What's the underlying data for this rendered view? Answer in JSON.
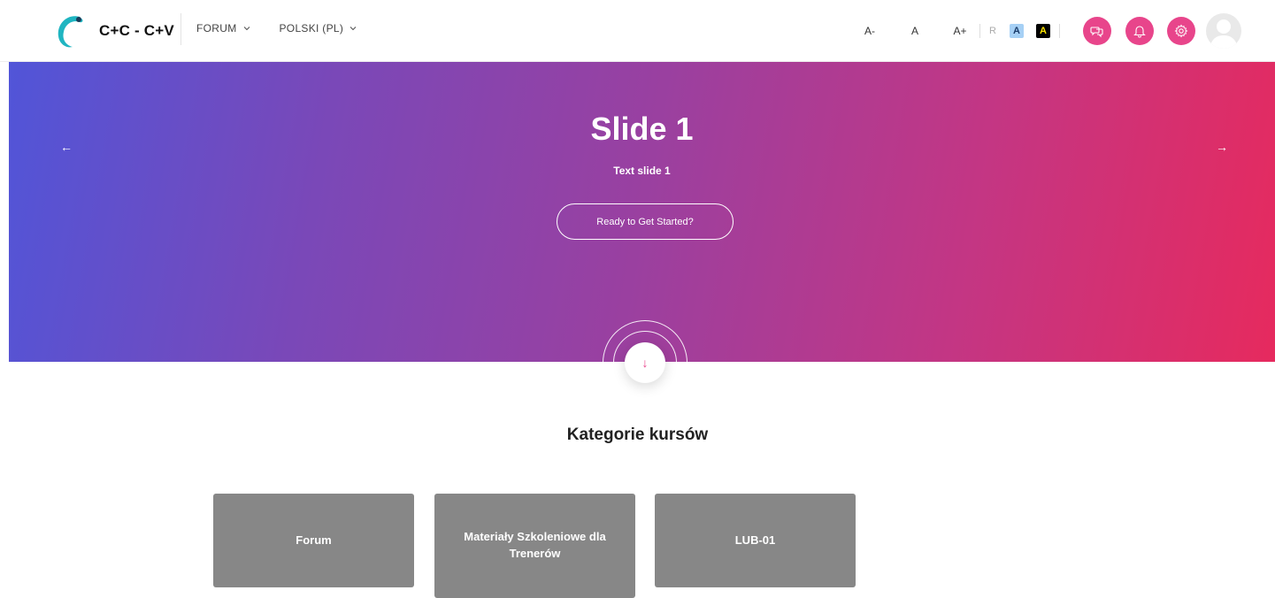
{
  "brand": {
    "name": "C+C - C+V",
    "logo_color": "#1fb5c1"
  },
  "nav": {
    "items": [
      {
        "label": "FORUM",
        "icon": "chevron-down-icon"
      },
      {
        "label": "POLSKI (PL)",
        "icon": "chevron-down-icon"
      }
    ]
  },
  "accessibility": {
    "font_decrease": "A-",
    "font_reset": "A",
    "font_increase": "A+",
    "reset": "R",
    "contrast_blue": "A",
    "contrast_black": "A"
  },
  "header_icons": {
    "accent": "#e8458b",
    "items": [
      "messages-icon",
      "notifications-icon",
      "settings-icon"
    ]
  },
  "hero": {
    "title": "Slide 1",
    "text": "Text slide 1",
    "button": "Ready to Get Started?",
    "prev_arrow": "←",
    "next_arrow": "→",
    "scroll_down": "↓"
  },
  "categories": {
    "title": "Kategorie kursów",
    "items": [
      {
        "label": "Forum"
      },
      {
        "label": "Materiały Szkoleniowe dla Trenerów"
      },
      {
        "label": "LUB-01"
      }
    ]
  }
}
